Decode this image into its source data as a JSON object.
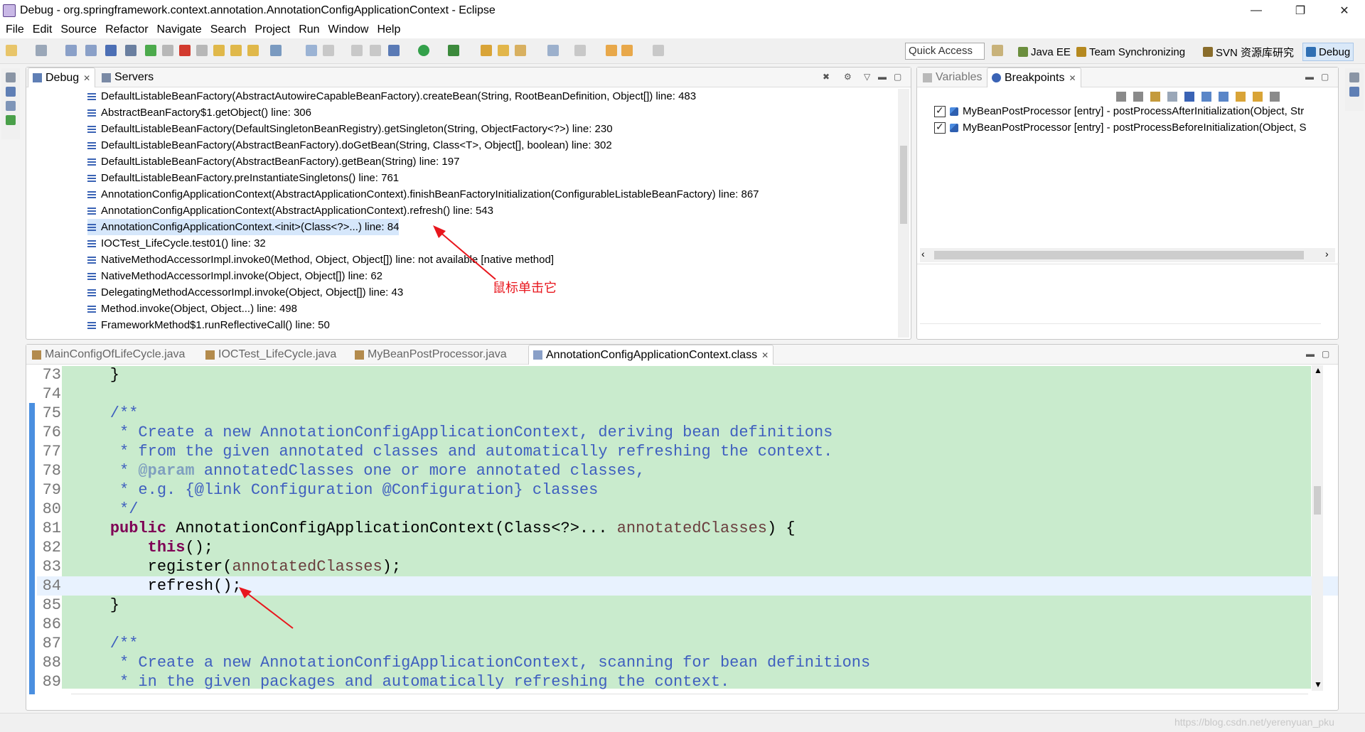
{
  "window": {
    "title": "Debug - org.springframework.context.annotation.AnnotationConfigApplicationContext - Eclipse",
    "min": "—",
    "max": "❐",
    "close": "✕"
  },
  "menu": [
    "File",
    "Edit",
    "Source",
    "Refactor",
    "Navigate",
    "Search",
    "Project",
    "Run",
    "Window",
    "Help"
  ],
  "toolbar": {
    "quick_access_placeholder": "Quick Access"
  },
  "perspectives": [
    {
      "label": "Java EE",
      "color": "#6b8e3d"
    },
    {
      "label": "Team Synchronizing",
      "color": "#b5891f"
    },
    {
      "label": "SVN 资源库研究",
      "color": "#8a6d2b"
    },
    {
      "label": "Debug",
      "color": "#2f6fb3",
      "active": true
    }
  ],
  "debug_view": {
    "tabs": [
      {
        "label": "Debug",
        "icon": "debug-icon"
      },
      {
        "label": "Servers",
        "icon": "servers-icon"
      }
    ],
    "frames": [
      "DefaultListableBeanFactory(AbstractAutowireCapableBeanFactory).createBean(String, RootBeanDefinition, Object[]) line: 483",
      "AbstractBeanFactory$1.getObject() line: 306",
      "DefaultListableBeanFactory(DefaultSingletonBeanRegistry).getSingleton(String, ObjectFactory<?>) line: 230",
      "DefaultListableBeanFactory(AbstractBeanFactory).doGetBean(String, Class<T>, Object[], boolean) line: 302",
      "DefaultListableBeanFactory(AbstractBeanFactory).getBean(String) line: 197",
      "DefaultListableBeanFactory.preInstantiateSingletons() line: 761",
      "AnnotationConfigApplicationContext(AbstractApplicationContext).finishBeanFactoryInitialization(ConfigurableListableBeanFactory) line: 867",
      "AnnotationConfigApplicationContext(AbstractApplicationContext).refresh() line: 543",
      "AnnotationConfigApplicationContext.<init>(Class<?>...) line: 84",
      "IOCTest_LifeCycle.test01() line: 32",
      "NativeMethodAccessorImpl.invoke0(Method, Object, Object[]) line: not available [native method]",
      "NativeMethodAccessorImpl.invoke(Object, Object[]) line: 62",
      "DelegatingMethodAccessorImpl.invoke(Object, Object[]) line: 43",
      "Method.invoke(Object, Object...) line: 498",
      "FrameworkMethod$1.runReflectiveCall() line: 50"
    ],
    "selected_index": 8,
    "annotation": "鼠标单击它"
  },
  "breakpoints_view": {
    "tabs": [
      {
        "label": "Variables"
      },
      {
        "label": "Breakpoints"
      }
    ],
    "items": [
      "MyBeanPostProcessor [entry] - postProcessAfterInitialization(Object, Str",
      "MyBeanPostProcessor [entry] - postProcessBeforeInitialization(Object, S"
    ]
  },
  "editor": {
    "tabs": [
      {
        "label": "MainConfigOfLifeCycle.java"
      },
      {
        "label": "IOCTest_LifeCycle.java"
      },
      {
        "label": "MyBeanPostProcessor.java"
      },
      {
        "label": "AnnotationConfigApplicationContext.class",
        "active": true
      }
    ],
    "line_numbers": [
      "73",
      "74",
      "75",
      "76",
      "77",
      "78",
      "79",
      "80",
      "81",
      "82",
      "83",
      "84",
      "85",
      "86",
      "87",
      "88",
      "89"
    ],
    "current_line": "84"
  },
  "status": {
    "watermark": "https://blog.csdn.net/yerenyuan_pku"
  }
}
